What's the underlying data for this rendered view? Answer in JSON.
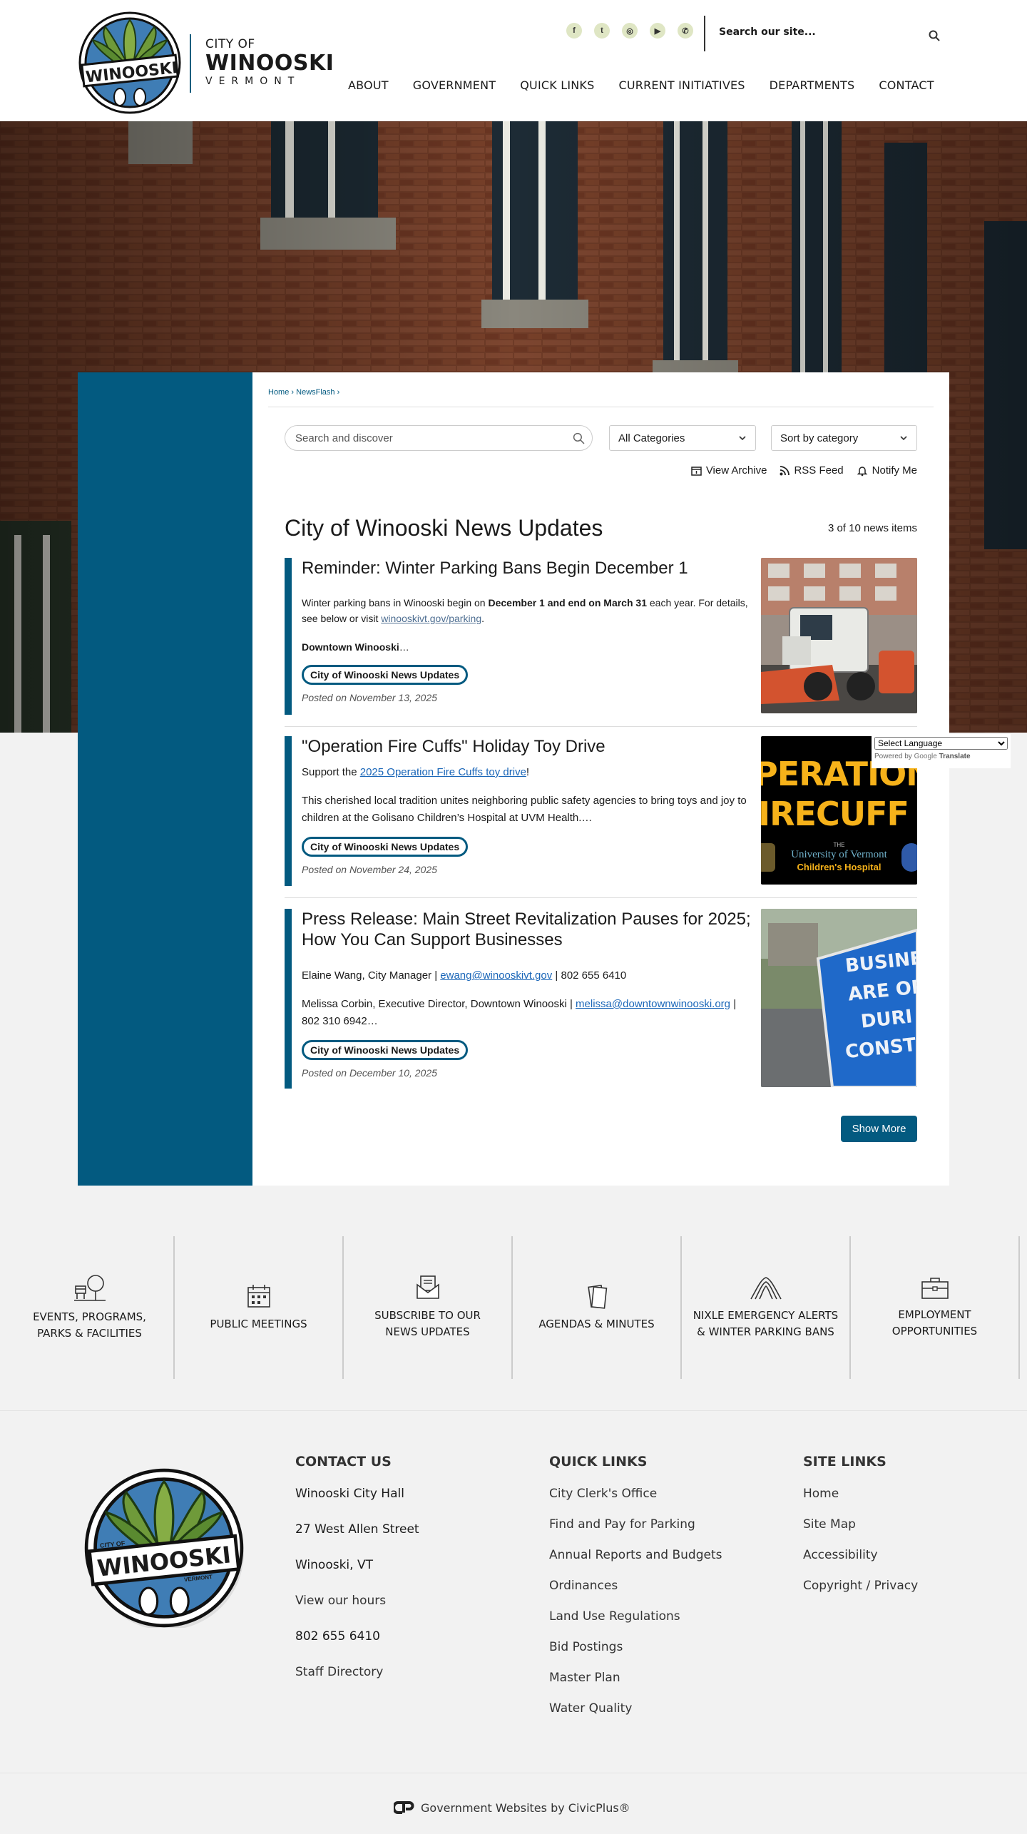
{
  "header": {
    "logo_line1": "CITY OF",
    "logo_line2": "WINOOSKI",
    "logo_line3": "VERMONT",
    "badge_name": "WINOOSKI",
    "search_placeholder": "Search our site...",
    "social": [
      {
        "icon": "facebook-icon",
        "glyph": "f"
      },
      {
        "icon": "twitter-icon",
        "glyph": "t"
      },
      {
        "icon": "instagram-icon",
        "glyph": "◎"
      },
      {
        "icon": "youtube-icon",
        "glyph": "▶"
      },
      {
        "icon": "whatsapp-icon",
        "glyph": "✆"
      }
    ],
    "nav": [
      "ABOUT",
      "GOVERNMENT",
      "QUICK LINKS",
      "CURRENT INITIATIVES",
      "DEPARTMENTS",
      "CONTACT"
    ]
  },
  "breadcrumb": {
    "home": "Home",
    "sep": "›",
    "current": "NewsFlash",
    "sep2": "›"
  },
  "filters": {
    "search_placeholder": "Search and discover",
    "categories": "All Categories",
    "sort": "Sort by category"
  },
  "actions": {
    "archive": "View Archive",
    "rss": "RSS Feed",
    "notify": "Notify Me"
  },
  "page": {
    "title": "City of Winooski News Updates",
    "count": "3 of 10 news items"
  },
  "news": [
    {
      "title": "Reminder: Winter Parking Bans Begin December 1",
      "p1a": "Winter parking bans in Winooski begin on ",
      "p1b": "December 1 and end on March 31",
      "p1c": " each year. For details, see below or visit ",
      "p1link": "winooskivt.gov/parking",
      "p1d": ".",
      "p2a": "Downtown Winooski",
      "p2b": "…",
      "tag": "City of Winooski News Updates",
      "posted": "Posted on November 13, 2025"
    },
    {
      "title": "\"Operation Fire Cuffs\" Holiday Toy Drive",
      "p1a": "Support the ",
      "p1link": "2025 Operation Fire Cuffs toy drive",
      "p1b": "!",
      "p2": "This cherished local tradition unites neighboring public safety agencies to bring toys and joy to children at the Golisano Children’s Hospital at UVM Health.…",
      "tag": "City of Winooski News Updates",
      "posted": "Posted on November 24, 2025",
      "img_line1": "PERATIONS",
      "img_line2": "IRECUFF",
      "img_line3": "THE",
      "img_line4": "University of Vermont",
      "img_line5": "Children's Hospital"
    },
    {
      "title": "Press Release: Main Street Revitalization Pauses for 2025; How You Can Support Businesses",
      "p1a": "Elaine Wang, City Manager | ",
      "p1link": "ewang@winooskivt.gov",
      "p1b": " | 802 655 6410",
      "p2a": "Melissa Corbin, Executive Director, Downtown Winooski | ",
      "p2link": "melissa@downtownwinooski.org",
      "p2b": " | 802 310 6942…",
      "tag": "City of Winooski News Updates",
      "posted": "Posted on December 10, 2025",
      "img_line1": "BUSINE",
      "img_line2": "ARE OP",
      "img_line3": "DURI",
      "img_line4": "CONSTR"
    }
  ],
  "show_more": "Show More",
  "translate": {
    "select": "Select Language",
    "powered": "Powered by",
    "google": "Google",
    "translate": "Translate"
  },
  "tiles": [
    {
      "icon": "tree-icon",
      "l1": "EVENTS, PROGRAMS,",
      "l2": "PARKS & FACILITIES"
    },
    {
      "icon": "calendar-icon",
      "l1": "PUBLIC MEETINGS",
      "l2": ""
    },
    {
      "icon": "envelope-icon",
      "l1": "SUBSCRIBE TO OUR",
      "l2": "NEWS UPDATES"
    },
    {
      "icon": "documents-icon",
      "l1": "AGENDAS & MINUTES",
      "l2": ""
    },
    {
      "icon": "alert-icon",
      "l1": "NIXLE EMERGENCY ALERTS",
      "l2": "& WINTER PARKING BANS"
    },
    {
      "icon": "briefcase-icon",
      "l1": "EMPLOYMENT",
      "l2": "OPPORTUNITIES"
    }
  ],
  "footer": {
    "contact_title": "CONTACT US",
    "contact": [
      "Winooski City Hall",
      "27 West Allen Street",
      "Winooski, VT",
      "View our hours",
      "802 655 6410",
      "Staff Directory"
    ],
    "quick_title": "QUICK LINKS",
    "quick": [
      "City Clerk's Office",
      "Find and Pay for Parking",
      "Annual Reports and Budgets",
      "Ordinances",
      "Land Use Regulations",
      "Bid Postings",
      "Master Plan",
      "Water Quality"
    ],
    "site_title": "SITE LINKS",
    "site": [
      "Home",
      "Site Map",
      "Accessibility",
      "Copyright / Privacy"
    ],
    "badge_top": "CITY OF",
    "badge_name": "WINOOSKI",
    "badge_right": "VERMONT"
  },
  "bottom": {
    "text": "Government Websites by CivicPlus®"
  },
  "colors": {
    "primary": "#035a80",
    "link": "#1a66b8",
    "background": "#f2f2f2",
    "accent_green": "#7aa23a"
  }
}
